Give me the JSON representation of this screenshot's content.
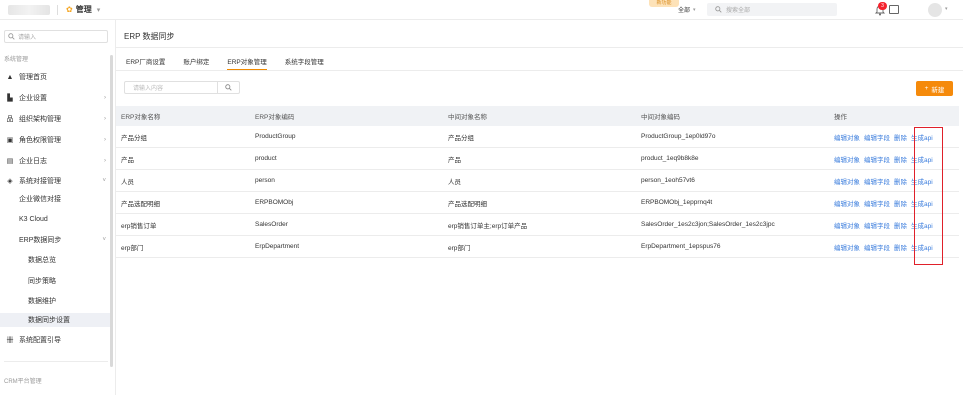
{
  "topbar": {
    "brand_label": "管理",
    "yellow_tag": "新功能",
    "scope_label": "全部",
    "search_placeholder": "搜索全部",
    "notification_count": "3"
  },
  "sidebar": {
    "search_placeholder": "请输入",
    "group_system": "系统管理",
    "items": [
      {
        "label": "管理首页"
      },
      {
        "label": "企业设置"
      },
      {
        "label": "组织架构管理"
      },
      {
        "label": "角色权限管理"
      },
      {
        "label": "企业日志"
      },
      {
        "label": "系统对接管理"
      }
    ],
    "sub_items": [
      {
        "label": "企业微信对接"
      },
      {
        "label": "K3 Cloud"
      },
      {
        "label": "ERP数据同步"
      }
    ],
    "sub2_items": [
      {
        "label": "数据总览"
      },
      {
        "label": "同步策略"
      },
      {
        "label": "数据维护"
      },
      {
        "label": "数据同步设置"
      }
    ],
    "guide_label": "系统配置引导",
    "group_crm": "CRM平台管理"
  },
  "main": {
    "page_title": "ERP 数据同步",
    "tabs": [
      {
        "label": "ERP厂商设置"
      },
      {
        "label": "账户绑定"
      },
      {
        "label": "ERP对象管理"
      },
      {
        "label": "系统字段管理"
      }
    ],
    "search_placeholder": "请输入内容",
    "new_button": "新建"
  },
  "table": {
    "headers": [
      "ERP对象名称",
      "ERP对象编码",
      "中间对象名称",
      "中间对象编码",
      "操作"
    ],
    "rows": [
      [
        "产品分组",
        "ProductGroup",
        "产品分组",
        "ProductGroup_1ep0ld97o"
      ],
      [
        "产品",
        "product",
        "产品",
        "product_1eq9b8k8e"
      ],
      [
        "人员",
        "person",
        "人员",
        "person_1eoh57vt6"
      ],
      [
        "产品选配明细",
        "ERPBOMObj",
        "产品选配明细",
        "ERPBOMObj_1epprnq4t"
      ],
      [
        "erp销售订单",
        "SalesOrder",
        "erp销售订单主;erp订单产品",
        "SalesOrder_1es2c3jon;SalesOrder_1es2c3jpc"
      ],
      [
        "erp部门",
        "ErpDepartment",
        "erp部门",
        "ErpDepartment_1epspus76"
      ]
    ],
    "actions": [
      "编辑对象",
      "编辑字段",
      "删除",
      "生成api"
    ]
  }
}
